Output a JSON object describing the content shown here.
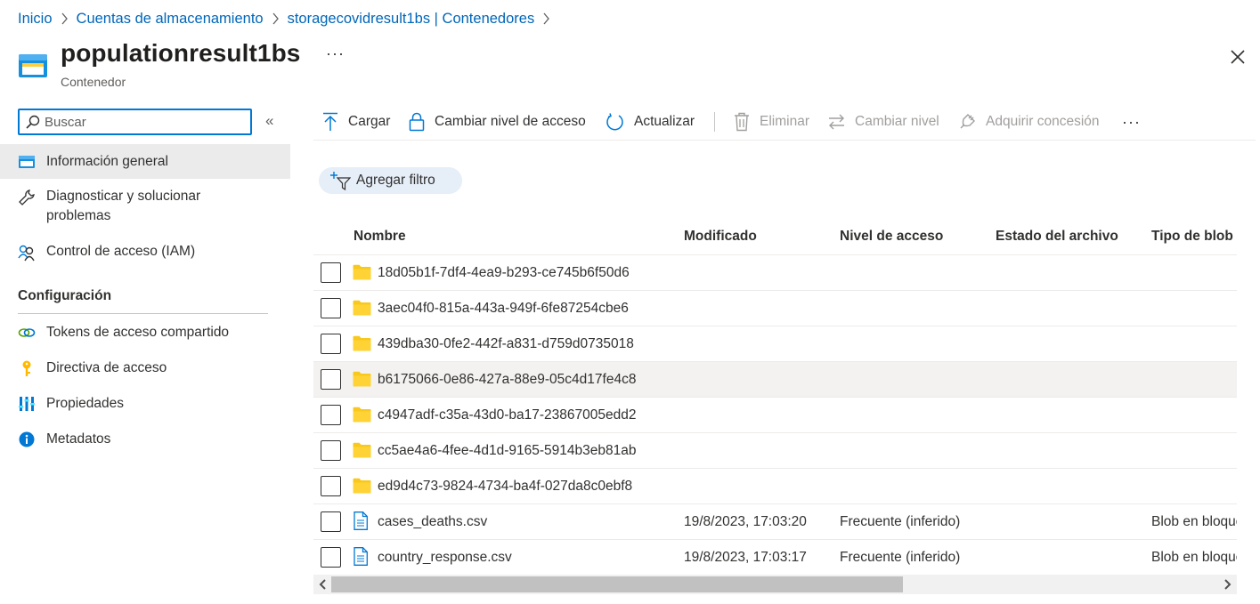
{
  "breadcrumb": {
    "items": [
      "Inicio",
      "Cuentas de almacenamiento",
      "storagecovidresult1bs | Contenedores"
    ]
  },
  "header": {
    "title": "populationresult1bs",
    "subtitle": "Contenedor",
    "more_label": "···"
  },
  "sidebar": {
    "search_placeholder": "Buscar",
    "collapse_label": "«",
    "items": [
      {
        "label": "Información general",
        "icon": "overview-icon"
      },
      {
        "label": "Diagnosticar y solucionar problemas",
        "icon": "wrench-icon"
      },
      {
        "label": "Control de acceso (IAM)",
        "icon": "people-icon"
      }
    ],
    "section_title": "Configuración",
    "config_items": [
      {
        "label": "Tokens de acceso compartido",
        "icon": "link-icon"
      },
      {
        "label": "Directiva de acceso",
        "icon": "key-icon"
      },
      {
        "label": "Propiedades",
        "icon": "properties-icon"
      },
      {
        "label": "Metadatos",
        "icon": "info-icon"
      }
    ]
  },
  "toolbar": {
    "upload": "Cargar",
    "change_access": "Cambiar nivel de acceso",
    "refresh": "Actualizar",
    "delete": "Eliminar",
    "change_tier": "Cambiar nivel",
    "acquire_lease": "Adquirir concesión",
    "more": "···"
  },
  "filter": {
    "label": "Agregar filtro"
  },
  "table": {
    "columns": [
      "Nombre",
      "Modificado",
      "Nivel de acceso",
      "Estado del archivo",
      "Tipo de blob"
    ],
    "rows": [
      {
        "name": "18d05b1f-7df4-4ea9-b293-ce745b6f50d6",
        "type": "folder",
        "modified": "",
        "access": "",
        "archive": "",
        "blob_type": ""
      },
      {
        "name": "3aec04f0-815a-443a-949f-6fe87254cbe6",
        "type": "folder",
        "modified": "",
        "access": "",
        "archive": "",
        "blob_type": ""
      },
      {
        "name": "439dba30-0fe2-442f-a831-d759d0735018",
        "type": "folder",
        "modified": "",
        "access": "",
        "archive": "",
        "blob_type": ""
      },
      {
        "name": "b6175066-0e86-427a-88e9-05c4d17fe4c8",
        "type": "folder",
        "modified": "",
        "access": "",
        "archive": "",
        "blob_type": ""
      },
      {
        "name": "c4947adf-c35a-43d0-ba17-23867005edd2",
        "type": "folder",
        "modified": "",
        "access": "",
        "archive": "",
        "blob_type": ""
      },
      {
        "name": "cc5ae4a6-4fee-4d1d-9165-5914b3eb81ab",
        "type": "folder",
        "modified": "",
        "access": "",
        "archive": "",
        "blob_type": ""
      },
      {
        "name": "ed9d4c73-9824-4734-ba4f-027da8c0ebf8",
        "type": "folder",
        "modified": "",
        "access": "",
        "archive": "",
        "blob_type": ""
      },
      {
        "name": "cases_deaths.csv",
        "type": "file",
        "modified": "19/8/2023, 17:03:20",
        "access": "Frecuente (inferido)",
        "archive": "",
        "blob_type": "Blob en bloques"
      },
      {
        "name": "country_response.csv",
        "type": "file",
        "modified": "19/8/2023, 17:03:17",
        "access": "Frecuente (inferido)",
        "archive": "",
        "blob_type": "Blob en bloques"
      }
    ]
  },
  "colors": {
    "link": "#0066b8",
    "accent": "#0078d4",
    "folder": "#f8c81c",
    "selected_nav": "#ebebeb",
    "hover_row": "#f3f2f1",
    "disabled": "#a19f9d"
  }
}
